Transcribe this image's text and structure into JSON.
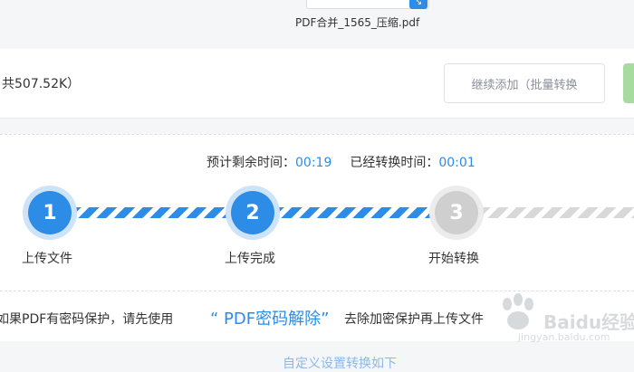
{
  "file": {
    "name": "PDF合并_1565_压缩.pdf",
    "corner_icon": "chevron-icon"
  },
  "action_bar": {
    "total_size": "共507.52K）",
    "add_button_label": "继续添加（批量转换"
  },
  "progress": {
    "remaining_label": "预计剩余时间：",
    "remaining_value": "00:19",
    "elapsed_label": "已经转换时间：",
    "elapsed_value": "00:01",
    "steps": [
      {
        "number": "1",
        "label": "上传文件",
        "status": "done"
      },
      {
        "number": "2",
        "label": "上传完成",
        "status": "done"
      },
      {
        "number": "3",
        "label": "开始转换",
        "status": "pending"
      }
    ]
  },
  "notice": {
    "prefix": "如果PDF有密码保护，请先使用",
    "link": "“ PDF密码解除”",
    "suffix": "去除加密保护再上传文件"
  },
  "bottom_link": "自定义设置转换如下",
  "watermark": {
    "brand": "Baidu经验",
    "url": "jingyan.baidu.com"
  },
  "colors": {
    "accent_blue": "#2d8ce6",
    "pending_gray": "#cfcfcf",
    "green_button": "#a7dba0"
  }
}
